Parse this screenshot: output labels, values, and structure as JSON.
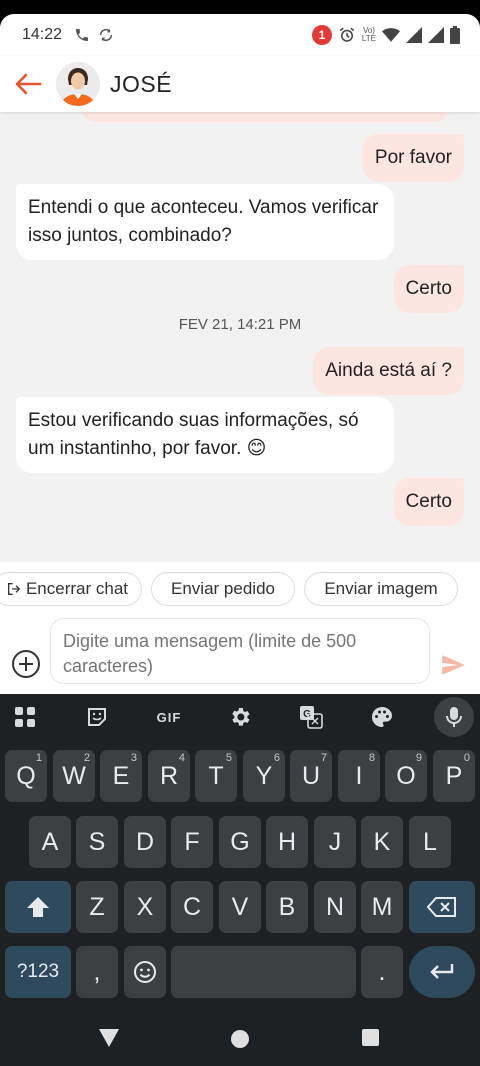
{
  "status_bar": {
    "time": "14:22",
    "notification_count": "1",
    "network_top": "Vo)",
    "network_bottom": "LTE"
  },
  "header": {
    "contact_name": "JOSÉ"
  },
  "chat": {
    "messages": [
      {
        "direction": "out",
        "text": "Por favor"
      },
      {
        "direction": "in",
        "text": "Entendi o que aconteceu. Vamos verificar isso juntos, combinado?"
      },
      {
        "direction": "out",
        "text": "Certo"
      },
      {
        "direction": "date",
        "text": "FEV 21, 14:21 PM"
      },
      {
        "direction": "out",
        "text": "Ainda está aí ?"
      },
      {
        "direction": "in",
        "text": "Estou verificando suas informações, só um instantinho, por favor. 😊"
      },
      {
        "direction": "out",
        "text": "Certo"
      }
    ]
  },
  "quick_actions": {
    "end_chat": "Encerrar chat",
    "send_order": "Enviar pedido",
    "send_image": "Enviar imagem"
  },
  "composer": {
    "placeholder": "Digite uma mensagem (limite de 500 caracteres)",
    "value": ""
  },
  "keyboard": {
    "tools": [
      "apps-icon",
      "sticker-icon",
      "gif-icon",
      "settings-icon",
      "translate-icon",
      "palette-icon",
      "mic-icon"
    ],
    "gif_label": "GIF",
    "row1": [
      {
        "key": "Q",
        "hint": "1"
      },
      {
        "key": "W",
        "hint": "2"
      },
      {
        "key": "E",
        "hint": "3"
      },
      {
        "key": "R",
        "hint": "4"
      },
      {
        "key": "T",
        "hint": "5"
      },
      {
        "key": "Y",
        "hint": "6"
      },
      {
        "key": "U",
        "hint": "7"
      },
      {
        "key": "I",
        "hint": "8"
      },
      {
        "key": "O",
        "hint": "9"
      },
      {
        "key": "P",
        "hint": "0"
      }
    ],
    "row2": [
      "A",
      "S",
      "D",
      "F",
      "G",
      "H",
      "J",
      "K",
      "L"
    ],
    "row3": [
      "Z",
      "X",
      "C",
      "V",
      "B",
      "N",
      "M"
    ],
    "symbols_key": "?123",
    "comma_key": ",",
    "period_key": "."
  },
  "colors": {
    "accent": "#e8562f",
    "outgoing_bubble": "#fde6e0",
    "incoming_bubble": "#ffffff",
    "chat_background": "#f2f2f2",
    "keyboard_background": "#1e2124",
    "key_background": "#3c4043"
  }
}
